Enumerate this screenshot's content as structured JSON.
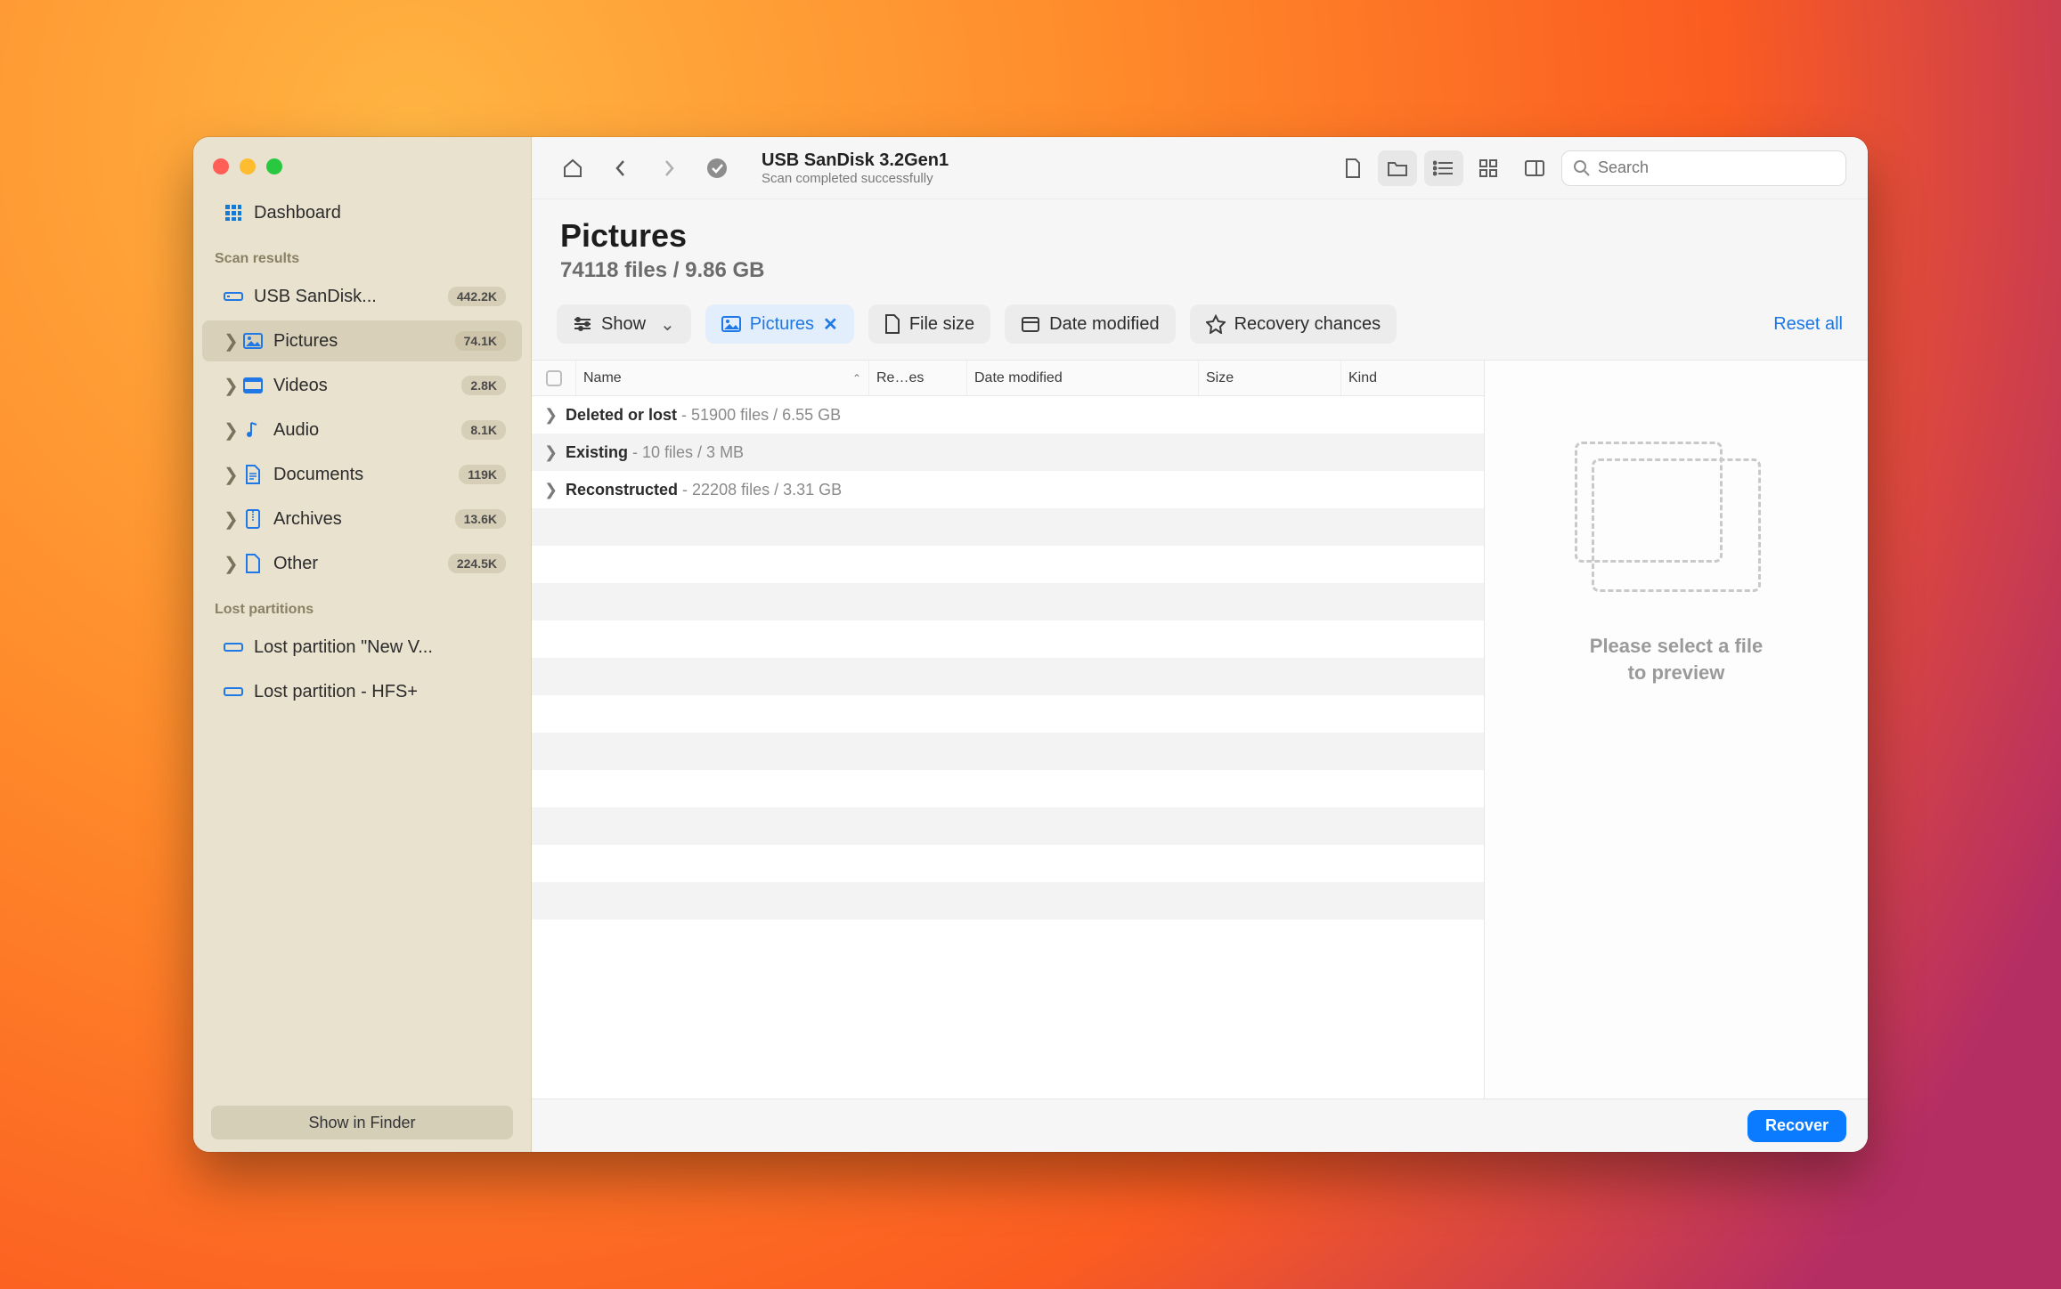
{
  "sidebar": {
    "dashboard_label": "Dashboard",
    "scan_results_header": "Scan results",
    "drive_label": "USB  SanDisk...",
    "drive_badge": "442.2K",
    "categories": [
      {
        "label": "Pictures",
        "badge": "74.1K"
      },
      {
        "label": "Videos",
        "badge": "2.8K"
      },
      {
        "label": "Audio",
        "badge": "8.1K"
      },
      {
        "label": "Documents",
        "badge": "119K"
      },
      {
        "label": "Archives",
        "badge": "13.6K"
      },
      {
        "label": "Other",
        "badge": "224.5K"
      }
    ],
    "lost_header": "Lost partitions",
    "lost": [
      {
        "label": "Lost partition \"New V..."
      },
      {
        "label": "Lost partition - HFS+"
      }
    ],
    "show_in_finder": "Show in Finder"
  },
  "toolbar": {
    "title": "USB  SanDisk 3.2Gen1",
    "subtitle": "Scan completed successfully",
    "search_placeholder": "Search"
  },
  "heading": {
    "title": "Pictures",
    "subtitle": "74118 files / 9.86 GB"
  },
  "filters": {
    "show": "Show",
    "pictures": "Pictures",
    "filesize": "File size",
    "date": "Date modified",
    "recovery": "Recovery chances",
    "reset": "Reset all"
  },
  "columns": {
    "name": "Name",
    "res": "Re…es",
    "date": "Date modified",
    "size": "Size",
    "kind": "Kind"
  },
  "rows": [
    {
      "label": "Deleted or lost",
      "meta": "51900 files / 6.55 GB"
    },
    {
      "label": "Existing",
      "meta": "10 files / 3 MB"
    },
    {
      "label": "Reconstructed",
      "meta": "22208 files / 3.31 GB"
    }
  ],
  "preview": {
    "line1": "Please select a file",
    "line2": "to preview"
  },
  "footer": {
    "recover": "Recover"
  }
}
